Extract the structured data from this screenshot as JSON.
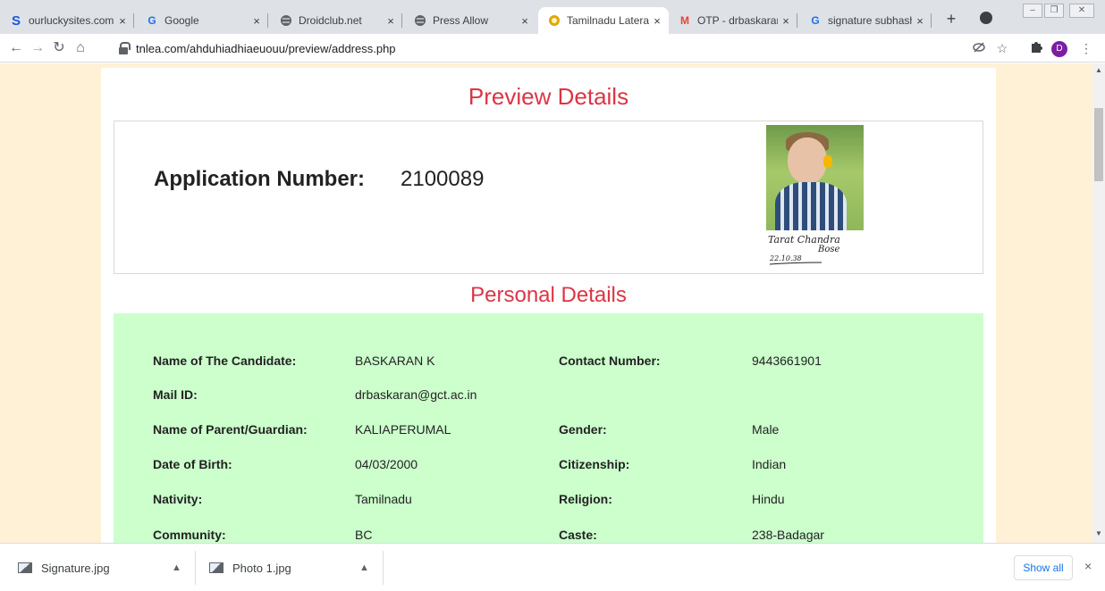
{
  "browser": {
    "tabs": [
      {
        "favicon": "S",
        "favicon_color": "#1a56db",
        "label": "ourluckysites.com"
      },
      {
        "favicon": "G",
        "favicon_color": "#1a73e8",
        "label": "Google"
      },
      {
        "favicon": "globe-icon",
        "favicon_color": "#5f6368",
        "label": "Droidclub.net"
      },
      {
        "favicon": "globe-icon",
        "favicon_color": "#5f6368",
        "label": "Press Allow"
      },
      {
        "favicon": "emblem-icon",
        "favicon_color": "#e0a800",
        "label": "Tamilnadu Lateral"
      },
      {
        "favicon": "M",
        "favicon_color": "#ea4335",
        "label": "OTP - drbaskaran@"
      },
      {
        "favicon": "G",
        "favicon_color": "#1a73e8",
        "label": "signature subhash"
      }
    ],
    "tab_close_glyph": "×",
    "new_tab_glyph": "+",
    "url": "tnlea.com/ahduhiadhiaeuouu/preview/address.php",
    "profile_initial": "D"
  },
  "page": {
    "preview_title": "Preview Details",
    "application_label": "Application Number:",
    "application_number": "2100089",
    "personal_title": "Personal Details",
    "signature_text": {
      "line1": "Tarat Chandra",
      "line2": "Bose",
      "date": "22.10.38"
    },
    "fields": [
      {
        "label": "Name of The Candidate:",
        "value": "BASKARAN K",
        "label2": "Contact Number:",
        "value2": "9443661901"
      },
      {
        "label": "Mail ID:",
        "value": "drbaskaran@gct.ac.in",
        "label2": "",
        "value2": ""
      },
      {
        "label": "Name of Parent/Guardian:",
        "value": "KALIAPERUMAL",
        "label2": "Gender:",
        "value2": "Male"
      },
      {
        "label": "Date of Birth:",
        "value": "04/03/2000",
        "label2": "Citizenship:",
        "value2": "Indian"
      },
      {
        "label": "Nativity:",
        "value": "Tamilnadu",
        "label2": "Religion:",
        "value2": "Hindu"
      },
      {
        "label": "Community:",
        "value": "BC",
        "label2": "Caste:",
        "value2": "238-Badagar"
      }
    ]
  },
  "downloads": {
    "items": [
      {
        "name": "Signature.jpg"
      },
      {
        "name": "Photo 1.jpg"
      }
    ],
    "show_all": "Show all",
    "close_glyph": "×"
  },
  "colors": {
    "heading_red": "#dc3545",
    "page_background": "#fff1d6",
    "details_background": "#ccffcc"
  }
}
